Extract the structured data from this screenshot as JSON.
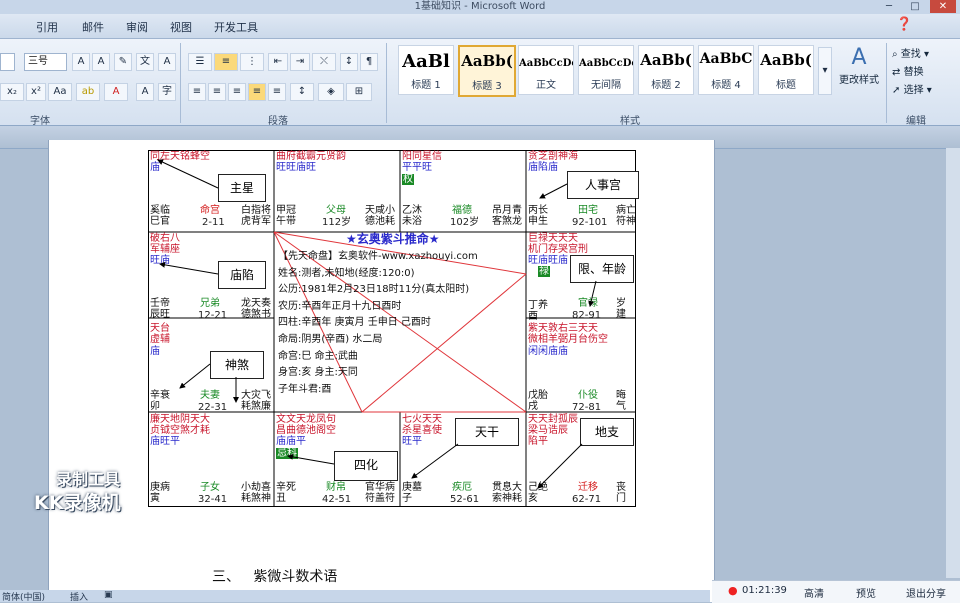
{
  "window": {
    "title": "1基础知识 - Microsoft Word",
    "controls": [
      "─",
      "□",
      "✕"
    ]
  },
  "menu": [
    "引用",
    "邮件",
    "审阅",
    "视图",
    "开发工具"
  ],
  "ribbon": {
    "font_size": "三号",
    "groups": {
      "font": "字体",
      "paragraph": "段落",
      "styles": "样式",
      "editing": "编辑"
    },
    "styles": [
      {
        "sample": "AaBl",
        "label": "标题 1",
        "size": "18px"
      },
      {
        "sample": "AaBb(",
        "label": "标题 3",
        "size": "15px"
      },
      {
        "sample": "AaBbCcDc",
        "label": "正文",
        "size": "10px"
      },
      {
        "sample": "AaBbCcDc",
        "label": "无间隔",
        "size": "10px"
      },
      {
        "sample": "AaBb(",
        "label": "标题 2",
        "size": "15px"
      },
      {
        "sample": "AaBbC",
        "label": "标题 4",
        "size": "14px"
      },
      {
        "sample": "AaBb(",
        "label": "标题",
        "size": "15px"
      }
    ],
    "change_styles": "更改样式",
    "find": "查找",
    "replace": "替换",
    "select": "选择"
  },
  "chart": {
    "center_title": "★玄奥紫斗推命★",
    "center_lines": [
      "【先天命盘】玄奥软件-www.xazhouyi.com",
      "姓名:测者,未知地(经度:120:0)",
      "公历:1981年2月23日18时11分(真太阳时)",
      "农历:辛酉年正月十九日酉时",
      "四柱:辛酉年 庚寅月 壬申日 己酉时",
      "命局:阴男(辛酉)  水二局",
      "命宫:巳      命主:武曲",
      "身宫:亥      身主:天同",
      "子年斗君:酉"
    ],
    "palaces": [
      {
        "id": "tl",
        "stars": "同左天铭蜂空",
        "status": "庙",
        "bottom_left": "奚临\n巳官",
        "name": "命宫",
        "range": "2-11",
        "bottom_right": "白指将\n虎背军"
      },
      {
        "id": "t2",
        "stars": "曲府截霸元贤韵",
        "status": "旺旺庙旺",
        "bottom_left": "甲冠\n午带",
        "name": "父母",
        "range": "112岁",
        "bottom_right": "天咸小\n德池耗"
      },
      {
        "id": "t3",
        "stars": "阳同星信",
        "status": "平平旺",
        "badge": "权",
        "bottom_left": "乙沐\n未浴",
        "name": "福德",
        "range": "102岁",
        "bottom_right": "吊月青\n客煞龙"
      },
      {
        "id": "tr",
        "stars": "贪芝剖神海",
        "status": "庙陷庙",
        "bottom_left": "丙长\n申生",
        "name": "田宅",
        "range": "92-101",
        "bottom_right": "病亡\n符神"
      },
      {
        "id": "l2",
        "stars": "破右八\n军辅座",
        "status": "旺庙",
        "bottom_left": "壬帝\n辰旺",
        "name": "兄弟",
        "range": "12-21",
        "bottom_right": "龙天奏\n德煞书"
      },
      {
        "id": "r2",
        "stars": "巨禄天天天\n机门存哭宫刑",
        "status": "旺庙旺庙",
        "badge": "禄",
        "bottom_left": "丁养\n酉",
        "name": "官禄",
        "range": "82-91",
        "bottom_right": "岁\n建"
      },
      {
        "id": "l3",
        "stars": "天台\n虚辅",
        "status": "庙",
        "bottom_left": "辛衰\n卯",
        "name": "夫妻",
        "range": "22-31",
        "bottom_right": "大灾飞\n耗煞廉"
      },
      {
        "id": "r3",
        "stars": "紫天敦右三天天\n微相羊弼月台伤空",
        "status": "闲闲庙庙",
        "bottom_left": "戊胎\n戌",
        "name": "仆役",
        "range": "72-81",
        "bottom_right": "晦\n气"
      },
      {
        "id": "bl",
        "stars": "廉天地阴天大\n贞钺空煞才耗",
        "status": "庙旺平",
        "bottom_left": "庚病\n寅",
        "name": "子女",
        "range": "32-41",
        "bottom_right": "小劫喜\n耗煞神"
      },
      {
        "id": "b2",
        "stars": "文文天龙凤句\n昌曲德池阁空",
        "status": "庙庙平",
        "badge": "忌科",
        "bottom_left": "辛死\n丑",
        "name": "财帛",
        "range": "42-51",
        "bottom_right": "官华病\n符盖符"
      },
      {
        "id": "b3",
        "stars": "七火天天\n杀星喜使",
        "status": "旺平",
        "bottom_left": "庚墓\n子",
        "name": "疾厄",
        "range": "52-61",
        "bottom_right": "贯息大\n索神耗"
      },
      {
        "id": "br",
        "stars": "天天封孤辰\n梁马诰辰\n陷平",
        "status": "",
        "bottom_left": "己绝\n亥",
        "name": "迁移",
        "range": "62-71",
        "bottom_right": "丧\n门"
      }
    ]
  },
  "callouts": [
    "主星",
    "人事宫",
    "庙陷",
    "限、年龄",
    "神煞",
    "天干",
    "地支",
    "四化"
  ],
  "section_title": "三、   紫微斗数术语",
  "status": {
    "language": "简体(中国)",
    "mode": "插入"
  },
  "recorder": {
    "time": "01:21:39",
    "quality": "高清",
    "preview": "预览",
    "exit": "退出分享",
    "watermark_top": "录制工具",
    "watermark_bottom": "KK录像机"
  }
}
